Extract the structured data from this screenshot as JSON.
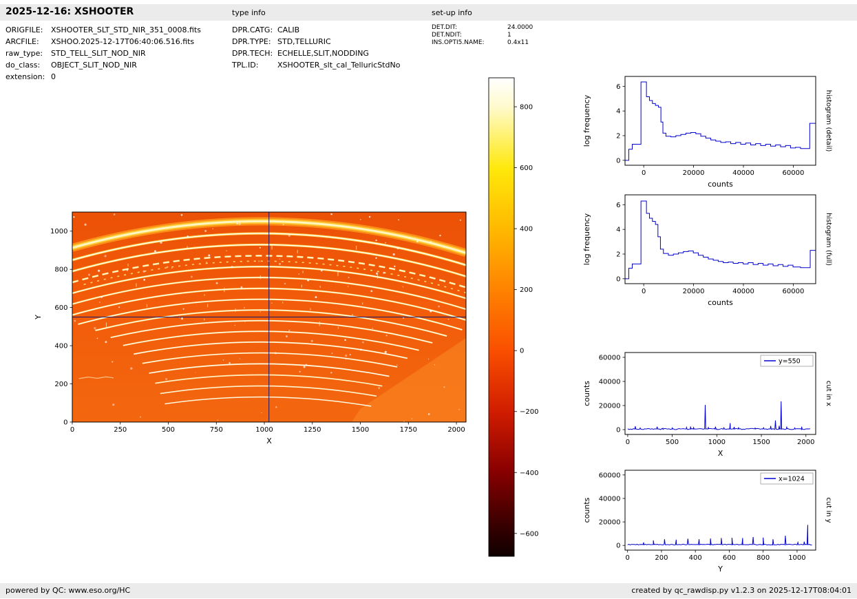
{
  "header": {
    "title": "2025-12-16: XSHOOTER",
    "type_info": "type info",
    "setup_info": "set-up info"
  },
  "metadata": {
    "left": [
      {
        "label": "ORIGFILE:",
        "value": "XSHOOTER_SLT_STD_NIR_351_0008.fits"
      },
      {
        "label": "ARCFILE:",
        "value": "XSHOO.2025-12-17T06:40:06.516.fits"
      },
      {
        "label": "raw_type:",
        "value": "STD_TELL_SLIT_NOD_NIR"
      },
      {
        "label": "do_class:",
        "value": "OBJECT_SLIT_NOD_NIR"
      },
      {
        "label": "extension:",
        "value": "0"
      }
    ],
    "middle": [
      {
        "label": "DPR.CATG:",
        "value": "CALIB"
      },
      {
        "label": "DPR.TYPE:",
        "value": "STD,TELLURIC"
      },
      {
        "label": "DPR.TECH:",
        "value": "ECHELLE,SLIT,NODDING"
      },
      {
        "label": "TPL.ID:",
        "value": "XSHOOTER_slt_cal_TelluricStdNo"
      }
    ],
    "right": [
      {
        "label": "DET.DIT:",
        "value": "24.0000"
      },
      {
        "label": "DET.NDIT:",
        "value": "1"
      },
      {
        "label": "INS.OPTI5.NAME:",
        "value": "0.4x11"
      }
    ]
  },
  "footer": {
    "left": "powered by QC: www.eso.org/HC",
    "right": "created by qc_rawdisp.py v1.2.3 on 2025-12-17T08:04:01"
  },
  "chart_data": [
    {
      "id": "main-image",
      "type": "heatmap",
      "title": "raw NIR echelle frame",
      "xlabel": "X",
      "ylabel": "Y",
      "xlim": [
        0,
        2050
      ],
      "ylim": [
        0,
        1100
      ],
      "xticks": [
        0,
        250,
        500,
        750,
        1000,
        1250,
        1500,
        1750,
        2000
      ],
      "yticks": [
        0,
        200,
        400,
        600,
        800,
        1000
      ],
      "crosshair": {
        "x": 1024,
        "y": 550
      },
      "colormap": "hot",
      "speckle_seed": 7,
      "speckles": 120,
      "streaks": 26,
      "orders": [
        {
          "apex": 1052,
          "x0": 0,
          "x1": 2050,
          "w": 7,
          "color": "#ffc832",
          "core": "#fff6c0",
          "coreW": 3,
          "glow": "#ff9e1c",
          "glowW": 12
        },
        {
          "apex": 988,
          "x0": 0,
          "x1": 2050,
          "w": 3.4,
          "color": "#ffd24a",
          "core": "#ffffff",
          "coreW": 1.4
        },
        {
          "apex": 929,
          "x0": 0,
          "x1": 2050,
          "w": 3.0,
          "color": "#ffd24a",
          "core": "#ffffff",
          "coreW": 1.3
        },
        {
          "apex": 871,
          "x0": 0,
          "x1": 2050,
          "w": 2.6,
          "color": "#ffe27c",
          "core": "#fffce2",
          "coreW": 1.2,
          "dash": "9 6"
        },
        {
          "apex": 843,
          "x0": 60,
          "x1": 2050,
          "w": 1.6,
          "color": "#ffd86a",
          "dash": "3 7"
        },
        {
          "apex": 814,
          "x0": 0,
          "x1": 2050,
          "w": 2.6,
          "color": "#ffd24a",
          "core": "#ffffff",
          "coreW": 1.3
        },
        {
          "apex": 757,
          "x0": 0,
          "x1": 2050,
          "w": 2.4,
          "color": "#ffd75e",
          "core": "#ffffff",
          "coreW": 1.2
        },
        {
          "apex": 700,
          "x0": 0,
          "x1": 2050,
          "w": 2.4,
          "color": "#ffd75e",
          "core": "#ffffff",
          "coreW": 1.2
        },
        {
          "apex": 643,
          "x0": 30,
          "x1": 2030,
          "w": 2.2,
          "color": "#ffdc70",
          "core": "#ffffff",
          "coreW": 1.1
        },
        {
          "apex": 587,
          "x0": 120,
          "x1": 1950,
          "w": 2.2,
          "color": "#ffdc70",
          "core": "#ffffff",
          "coreW": 1.1
        },
        {
          "apex": 531,
          "x0": 200,
          "x1": 1875,
          "w": 2.0,
          "color": "#ffe288",
          "core": "#ffffff",
          "coreW": 1.0
        },
        {
          "apex": 475,
          "x0": 265,
          "x1": 1805,
          "w": 2.0,
          "color": "#ffe288",
          "core": "#ffffff",
          "coreW": 1.0
        },
        {
          "apex": 419,
          "x0": 320,
          "x1": 1745,
          "w": 1.9,
          "color": "#ffe79a",
          "core": "#ffffff",
          "coreW": 1.0
        },
        {
          "apex": 362,
          "x0": 365,
          "x1": 1692,
          "w": 1.8,
          "color": "#ffe79a",
          "core": "#ffffff",
          "coreW": 0.9
        },
        {
          "apex": 305,
          "x0": 400,
          "x1": 1650,
          "w": 1.8,
          "color": "#ffefb2",
          "core": "#ffffff",
          "coreW": 0.9
        },
        {
          "apex": 247,
          "x0": 432,
          "x1": 1614,
          "w": 1.7,
          "color": "#fff3c2"
        },
        {
          "apex": 189,
          "x0": 458,
          "x1": 1584,
          "w": 1.6,
          "color": "#fff7d2"
        },
        {
          "apex": 131,
          "x0": 482,
          "x1": 1556,
          "w": 1.5,
          "color": "#fffae0"
        }
      ]
    },
    {
      "id": "colorbar",
      "type": "colorbar",
      "range": [
        -675,
        895
      ],
      "ticks": [
        800,
        600,
        400,
        200,
        0,
        -200,
        -400,
        -600
      ],
      "colormap": "hot",
      "stops": [
        [
          0,
          "#ffffff"
        ],
        [
          6,
          "#fffacd"
        ],
        [
          19,
          "#ffe80a"
        ],
        [
          31,
          "#ffbb00"
        ],
        [
          44,
          "#ff8400"
        ],
        [
          57,
          "#fa4f00"
        ],
        [
          70,
          "#d01c00"
        ],
        [
          82,
          "#8a0000"
        ],
        [
          95,
          "#2e0000"
        ],
        [
          100,
          "#100000"
        ]
      ]
    },
    {
      "id": "hist-detail",
      "type": "line",
      "step": true,
      "xlabel": "counts",
      "ylabel": "log frequency",
      "side_label": "histogram (detail)",
      "xlim": [
        -7500,
        69000
      ],
      "ylim": [
        -0.4,
        6.8
      ],
      "xticks": [
        0,
        20000,
        40000,
        60000
      ],
      "yticks": [
        0,
        2,
        4,
        6
      ],
      "color": "#0000cd",
      "points": [
        [
          -7500,
          0
        ],
        [
          -6000,
          0
        ],
        [
          -6000,
          0.9
        ],
        [
          -4600,
          0.9
        ],
        [
          -4600,
          1.3
        ],
        [
          -1100,
          1.3
        ],
        [
          -1100,
          6.35
        ],
        [
          1100,
          6.35
        ],
        [
          1100,
          5.15
        ],
        [
          2300,
          5.15
        ],
        [
          2300,
          4.85
        ],
        [
          3500,
          4.85
        ],
        [
          3500,
          4.6
        ],
        [
          4700,
          4.6
        ],
        [
          4700,
          4.45
        ],
        [
          5900,
          4.45
        ],
        [
          5900,
          4.3
        ],
        [
          6900,
          4.3
        ],
        [
          6900,
          3.1
        ],
        [
          7700,
          3.1
        ],
        [
          7700,
          2.2
        ],
        [
          8900,
          2.2
        ],
        [
          8900,
          1.95
        ],
        [
          10900,
          1.95
        ],
        [
          10900,
          1.9
        ],
        [
          12900,
          1.9
        ],
        [
          12900,
          2.0
        ],
        [
          14900,
          2.0
        ],
        [
          14900,
          2.1
        ],
        [
          16900,
          2.1
        ],
        [
          16900,
          2.2
        ],
        [
          18900,
          2.2
        ],
        [
          18900,
          2.25
        ],
        [
          20900,
          2.25
        ],
        [
          20900,
          2.15
        ],
        [
          22900,
          2.15
        ],
        [
          22900,
          1.95
        ],
        [
          24900,
          1.95
        ],
        [
          24900,
          1.8
        ],
        [
          26900,
          1.8
        ],
        [
          26900,
          1.65
        ],
        [
          28900,
          1.65
        ],
        [
          28900,
          1.55
        ],
        [
          30900,
          1.55
        ],
        [
          30900,
          1.45
        ],
        [
          32900,
          1.45
        ],
        [
          32900,
          1.5
        ],
        [
          34900,
          1.5
        ],
        [
          34900,
          1.35
        ],
        [
          36900,
          1.35
        ],
        [
          36900,
          1.45
        ],
        [
          38900,
          1.45
        ],
        [
          38900,
          1.3
        ],
        [
          40900,
          1.3
        ],
        [
          40900,
          1.4
        ],
        [
          42900,
          1.4
        ],
        [
          42900,
          1.25
        ],
        [
          44900,
          1.25
        ],
        [
          44900,
          1.35
        ],
        [
          46900,
          1.35
        ],
        [
          46900,
          1.2
        ],
        [
          48900,
          1.2
        ],
        [
          48900,
          1.3
        ],
        [
          50900,
          1.3
        ],
        [
          50900,
          1.15
        ],
        [
          52900,
          1.15
        ],
        [
          52900,
          1.25
        ],
        [
          54900,
          1.25
        ],
        [
          54900,
          1.1
        ],
        [
          56900,
          1.1
        ],
        [
          56900,
          1.2
        ],
        [
          58900,
          1.2
        ],
        [
          58900,
          1.0
        ],
        [
          60900,
          1.0
        ],
        [
          60900,
          1.05
        ],
        [
          62900,
          1.05
        ],
        [
          62900,
          0.95
        ],
        [
          66600,
          0.95
        ],
        [
          66600,
          3.0
        ],
        [
          69000,
          3.0
        ]
      ]
    },
    {
      "id": "hist-full",
      "type": "line",
      "step": true,
      "xlabel": "counts",
      "ylabel": "log frequency",
      "side_label": "histogram (full)",
      "xlim": [
        -7500,
        69000
      ],
      "ylim": [
        -0.4,
        6.8
      ],
      "xticks": [
        0,
        20000,
        40000,
        60000
      ],
      "yticks": [
        0,
        2,
        4,
        6
      ],
      "color": "#0000cd",
      "points": [
        [
          -7500,
          0
        ],
        [
          -6000,
          0
        ],
        [
          -6000,
          0.85
        ],
        [
          -4600,
          0.85
        ],
        [
          -4600,
          1.2
        ],
        [
          -1100,
          1.2
        ],
        [
          -1100,
          6.3
        ],
        [
          1100,
          6.3
        ],
        [
          1100,
          5.3
        ],
        [
          2300,
          5.3
        ],
        [
          2300,
          4.9
        ],
        [
          3500,
          4.9
        ],
        [
          3500,
          4.65
        ],
        [
          4700,
          4.65
        ],
        [
          4700,
          4.4
        ],
        [
          5700,
          4.4
        ],
        [
          5700,
          3.4
        ],
        [
          6700,
          3.4
        ],
        [
          6700,
          2.4
        ],
        [
          7900,
          2.4
        ],
        [
          7900,
          2.05
        ],
        [
          9900,
          2.05
        ],
        [
          9900,
          1.9
        ],
        [
          11900,
          1.9
        ],
        [
          11900,
          2.0
        ],
        [
          13900,
          2.0
        ],
        [
          13900,
          2.1
        ],
        [
          15900,
          2.1
        ],
        [
          15900,
          2.2
        ],
        [
          17900,
          2.2
        ],
        [
          17900,
          2.25
        ],
        [
          19900,
          2.25
        ],
        [
          19900,
          2.1
        ],
        [
          21900,
          2.1
        ],
        [
          21900,
          1.9
        ],
        [
          23900,
          1.9
        ],
        [
          23900,
          1.75
        ],
        [
          25900,
          1.75
        ],
        [
          25900,
          1.6
        ],
        [
          27900,
          1.6
        ],
        [
          27900,
          1.5
        ],
        [
          29900,
          1.5
        ],
        [
          29900,
          1.4
        ],
        [
          31900,
          1.4
        ],
        [
          31900,
          1.3
        ],
        [
          33900,
          1.3
        ],
        [
          33900,
          1.35
        ],
        [
          35900,
          1.35
        ],
        [
          35900,
          1.25
        ],
        [
          37900,
          1.25
        ],
        [
          37900,
          1.3
        ],
        [
          39900,
          1.3
        ],
        [
          39900,
          1.2
        ],
        [
          41900,
          1.2
        ],
        [
          41900,
          1.3
        ],
        [
          43900,
          1.3
        ],
        [
          43900,
          1.15
        ],
        [
          45900,
          1.15
        ],
        [
          45900,
          1.25
        ],
        [
          47900,
          1.25
        ],
        [
          47900,
          1.1
        ],
        [
          49900,
          1.1
        ],
        [
          49900,
          1.2
        ],
        [
          51900,
          1.2
        ],
        [
          51900,
          1.05
        ],
        [
          53900,
          1.05
        ],
        [
          53900,
          1.15
        ],
        [
          55900,
          1.15
        ],
        [
          55900,
          1.0
        ],
        [
          57900,
          1.0
        ],
        [
          57900,
          1.1
        ],
        [
          59900,
          1.1
        ],
        [
          59900,
          0.95
        ],
        [
          62900,
          0.95
        ],
        [
          62900,
          0.9
        ],
        [
          66800,
          0.9
        ],
        [
          66800,
          2.3
        ],
        [
          69000,
          2.3
        ]
      ]
    },
    {
      "id": "cut-x",
      "type": "line",
      "legend": "y=550",
      "xlabel": "X",
      "ylabel": "counts",
      "side_label": "cut in x",
      "xlim": [
        -30,
        2110
      ],
      "ylim": [
        -4000,
        64000
      ],
      "xticks": [
        0,
        500,
        1000,
        1500,
        2000
      ],
      "yticks": [
        0,
        20000,
        40000,
        60000
      ],
      "color": "#0000cd",
      "baseline": 500,
      "noise": 450,
      "seed": 3,
      "spike_halfwidth": 6,
      "sample_step": 16,
      "sample_max": 2048,
      "spikes": [
        [
          85,
          2800
        ],
        [
          140,
          1400
        ],
        [
          330,
          2400
        ],
        [
          395,
          1200
        ],
        [
          500,
          1400
        ],
        [
          660,
          1900
        ],
        [
          705,
          2600
        ],
        [
          740,
          1700
        ],
        [
          870,
          20500
        ],
        [
          905,
          1800
        ],
        [
          985,
          2400
        ],
        [
          1080,
          1600
        ],
        [
          1150,
          5400
        ],
        [
          1195,
          2200
        ],
        [
          1245,
          1900
        ],
        [
          1430,
          1300
        ],
        [
          1525,
          1600
        ],
        [
          1605,
          3000
        ],
        [
          1658,
          7600
        ],
        [
          1700,
          3200
        ],
        [
          1722,
          23500
        ],
        [
          1785,
          2100
        ],
        [
          1875,
          1400
        ],
        [
          1952,
          2400
        ]
      ]
    },
    {
      "id": "cut-y",
      "type": "line",
      "legend": "x=1024",
      "xlabel": "Y",
      "ylabel": "counts",
      "side_label": "cut in y",
      "xlim": [
        -15,
        1110
      ],
      "ylim": [
        -4000,
        64000
      ],
      "xticks": [
        0,
        200,
        400,
        600,
        800,
        1000
      ],
      "yticks": [
        0,
        20000,
        40000,
        60000
      ],
      "color": "#0000cd",
      "baseline": 700,
      "noise": 350,
      "seed": 9,
      "spike_halfwidth": 4,
      "sample_step": 8,
      "sample_max": 1095,
      "spikes": [
        [
          95,
          2600
        ],
        [
          152,
          4300
        ],
        [
          218,
          5300
        ],
        [
          287,
          4900
        ],
        [
          356,
          5700
        ],
        [
          422,
          5300
        ],
        [
          489,
          5900
        ],
        [
          553,
          6300
        ],
        [
          616,
          6500
        ],
        [
          679,
          6300
        ],
        [
          741,
          7100
        ],
        [
          800,
          6700
        ],
        [
          858,
          5300
        ],
        [
          931,
          8300
        ],
        [
          1005,
          2600
        ],
        [
          1042,
          3200
        ],
        [
          1063,
          17500
        ]
      ]
    }
  ]
}
